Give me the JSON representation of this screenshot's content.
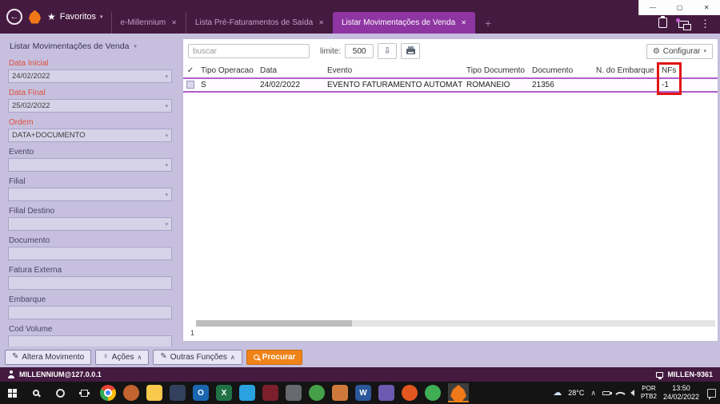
{
  "icons": {
    "back": "←",
    "star": "★",
    "chevron_down": "▾",
    "chevron_up": "∧",
    "close": "✕",
    "plus": "+",
    "dots": "⋮",
    "gear": "⚙",
    "check": "✓",
    "pencil": "✎",
    "pin": "♀",
    "minimize": "—",
    "maximize": "▢",
    "export": "⇩",
    "cloud": "☁"
  },
  "colors": {
    "titlebar": "#451a40",
    "tab_active": "#8e35a2",
    "sidebar": "#c6c0de",
    "accent_label": "#e0503c",
    "row_highlight": "#b060cc",
    "annotation": "#e21414",
    "procurar_orange": "#ef8318"
  },
  "titlebar": {
    "favorites_label": "Favoritos",
    "tabs": [
      {
        "label": "e-Millennium"
      },
      {
        "label": "Lista Pré-Faturamentos de Saída"
      },
      {
        "label": "Listar Movimentações de Venda"
      }
    ]
  },
  "sidebar": {
    "title": "Listar Movimentações de Venda",
    "fields": [
      {
        "label": "Data Inicial",
        "value": "24/02/2022"
      },
      {
        "label": "Data Final",
        "value": "25/02/2022"
      },
      {
        "label": "Ordem",
        "value": "DATA+DOCUMENTO"
      },
      {
        "label": "Evento",
        "value": ""
      },
      {
        "label": "Filial",
        "value": ""
      },
      {
        "label": "Filial Destino",
        "value": ""
      },
      {
        "label": "Documento",
        "value": ""
      },
      {
        "label": "Fatura Externa",
        "value": ""
      },
      {
        "label": "Embarque",
        "value": ""
      },
      {
        "label": "Cod Volume",
        "value": ""
      }
    ]
  },
  "toolbar": {
    "search_placeholder": "buscar",
    "limit_label": "limite:",
    "limit_value": "500",
    "configure_label": "Configurar"
  },
  "table": {
    "columns": [
      "Tipo Operacao",
      "Data",
      "Evento",
      "Tipo Documento",
      "Documento",
      "N. do Embarque",
      "NFs"
    ],
    "rows": [
      [
        "S",
        "24/02/2022",
        "EVENTO FATURAMENTO AUTOMÁTICO",
        "ROMANEIO",
        "21356",
        "",
        "-1"
      ]
    ],
    "footer_count": "1"
  },
  "actionbar": {
    "buttons": [
      "Altera Movimento",
      "Ações",
      "Outras Funções",
      "Procurar"
    ]
  },
  "statusbar": {
    "user": "MILLENNIUM@127.0.0.1",
    "machine": "MILLEN-9361"
  },
  "taskbar": {
    "apps": [
      {
        "name": "chrome",
        "color": "conic-gradient(from -60deg, #ea4335 0deg 120deg, #fbbc05 120deg 240deg, #34a853 240deg 360deg)",
        "glyph": ""
      },
      {
        "name": "browser-orange",
        "color": "#c3632f",
        "glyph": ""
      },
      {
        "name": "file-explorer",
        "color": "#f8c94c",
        "glyph": ""
      },
      {
        "name": "mail",
        "color": "#33415e",
        "glyph": ""
      },
      {
        "name": "outlook",
        "color": "#1a66b0",
        "glyph": "O"
      },
      {
        "name": "excel",
        "color": "#217346",
        "glyph": "X"
      },
      {
        "name": "vscode",
        "color": "#2aa2e0",
        "glyph": ""
      },
      {
        "name": "app-dark-red",
        "color": "#7a1f2b",
        "glyph": ""
      },
      {
        "name": "app-gray",
        "color": "#666a6e",
        "glyph": ""
      },
      {
        "name": "camera-green",
        "color": "#46a049",
        "glyph": ""
      },
      {
        "name": "app-tan",
        "color": "#cf7a3c",
        "glyph": ""
      },
      {
        "name": "word",
        "color": "#2b579a",
        "glyph": "W"
      },
      {
        "name": "app-purple",
        "color": "#6c5ab0",
        "glyph": ""
      },
      {
        "name": "app-orange-round",
        "color": "#e2571f",
        "glyph": ""
      },
      {
        "name": "camera-green-2",
        "color": "#3fae55",
        "glyph": ""
      },
      {
        "name": "millennium",
        "color": "#f07818",
        "glyph": ""
      }
    ],
    "tray": {
      "temperature": "28°C",
      "lang_line1": "POR",
      "lang_line2": "PTB2",
      "time": "13:50",
      "date": "24/02/2022"
    }
  }
}
